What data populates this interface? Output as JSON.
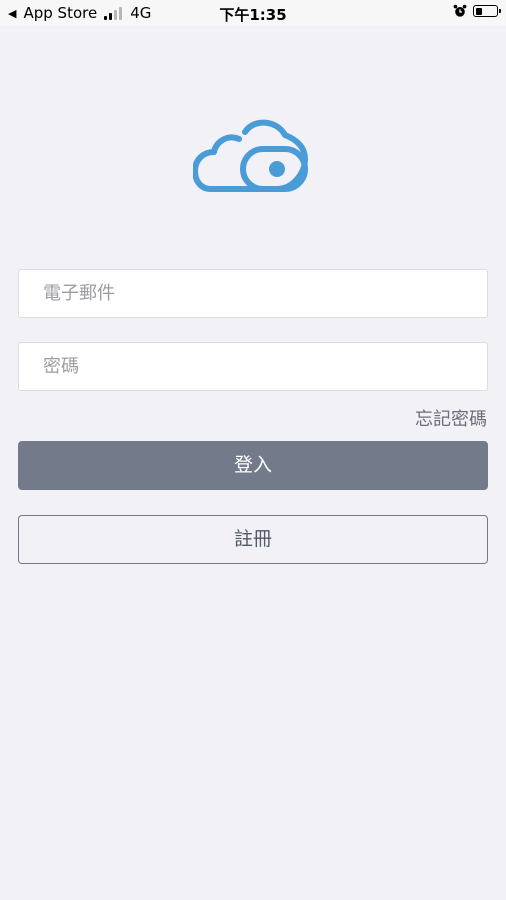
{
  "status_bar": {
    "back_app": "App Store",
    "network": "4G",
    "time": "下午1:35"
  },
  "colors": {
    "background": "#f1f1f6",
    "logo": "#4a9cd8",
    "button": "#737a89",
    "link": "#6b6f7b"
  },
  "logo": {
    "icon": "cloud-eye-icon"
  },
  "form": {
    "email_placeholder": "電子郵件",
    "password_placeholder": "密碼",
    "forgot_password": "忘記密碼",
    "login_label": "登入",
    "register_label": "註冊"
  }
}
